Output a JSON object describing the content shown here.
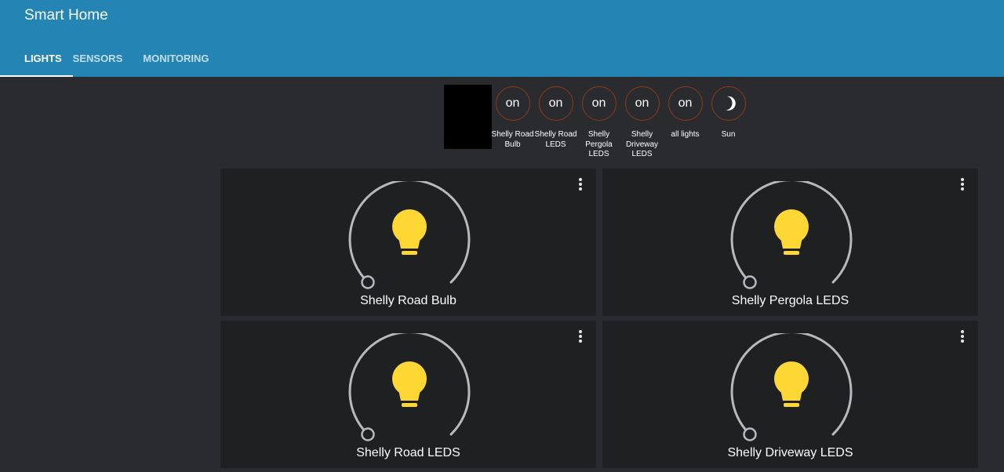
{
  "app": {
    "title": "Smart Home"
  },
  "tabs": [
    {
      "label": "LIGHTS",
      "active": true
    },
    {
      "label": "SENSORS",
      "active": false
    },
    {
      "label": "MONITORING",
      "active": false
    }
  ],
  "badges": [
    {
      "value": "on",
      "label": "Shelly Road Bulb"
    },
    {
      "value": "on",
      "label": "Shelly Road LEDS"
    },
    {
      "value": "on",
      "label": "Shelly Pergola LEDS"
    },
    {
      "value": "on",
      "label": "Shelly Driveway LEDS"
    },
    {
      "value": "on",
      "label": "all lights"
    },
    {
      "value": "",
      "label": "Sun",
      "icon": "moon-icon"
    }
  ],
  "cards": [
    {
      "name": "Shelly Road Bulb",
      "icon": "lightbulb-icon",
      "state": "on"
    },
    {
      "name": "Shelly Pergola LEDS",
      "icon": "lightbulb-icon",
      "state": "on"
    },
    {
      "name": "Shelly Road LEDS",
      "icon": "lightbulb-icon",
      "state": "on"
    },
    {
      "name": "Shelly Driveway LEDS",
      "icon": "lightbulb-icon",
      "state": "on"
    }
  ],
  "colors": {
    "header": "#2484b4",
    "background": "#2a2b2f",
    "card": "#1f2022",
    "bulb": "#fdd835",
    "gauge_track": "#b8b9bd",
    "badge_ring": "#8a3b1a"
  }
}
